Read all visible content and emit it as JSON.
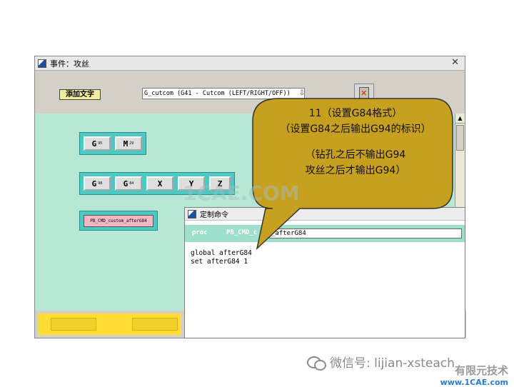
{
  "main_window": {
    "title": "事件：攻丝",
    "close": "✕",
    "add_text_button": "添加文字",
    "combo_value": "G_cutcom (G41 - Cutcom (LEFT/RIGHT/OFF))",
    "combo_arrow": "⇩",
    "blocks_row1": [
      {
        "letter": "G",
        "sub": "95"
      },
      {
        "letter": "M",
        "sub": "29"
      }
    ],
    "blocks_row2": [
      {
        "letter": "G",
        "sub": "98"
      },
      {
        "letter": "G",
        "sub": "84"
      },
      {
        "letter": "X",
        "sub": ""
      },
      {
        "letter": "Y",
        "sub": ""
      },
      {
        "letter": "Z",
        "sub": ""
      }
    ],
    "custom_block": "PB_CMD_custom_afterG84"
  },
  "command_window": {
    "title": "定制命令",
    "proc_keyword": "proc",
    "proc_name_prefix": "PB_CMD_c",
    "proc_name": "_afterG84",
    "code_lines": [
      "global afterG84",
      "set afterG84 1"
    ]
  },
  "callout": {
    "lines": [
      "11（设置G84格式）",
      "（设置G84之后输出G94的标识）",
      "",
      "（钻孔之后不输出G94",
      "攻丝之后才输出G94）"
    ],
    "fill": "#c8a020"
  },
  "watermark": "1CAE.COM",
  "footer": {
    "wechat": "微信号: lijian-xsteach",
    "brand_line1": "有限元技术",
    "brand_line2": "www.1CAE.com"
  }
}
